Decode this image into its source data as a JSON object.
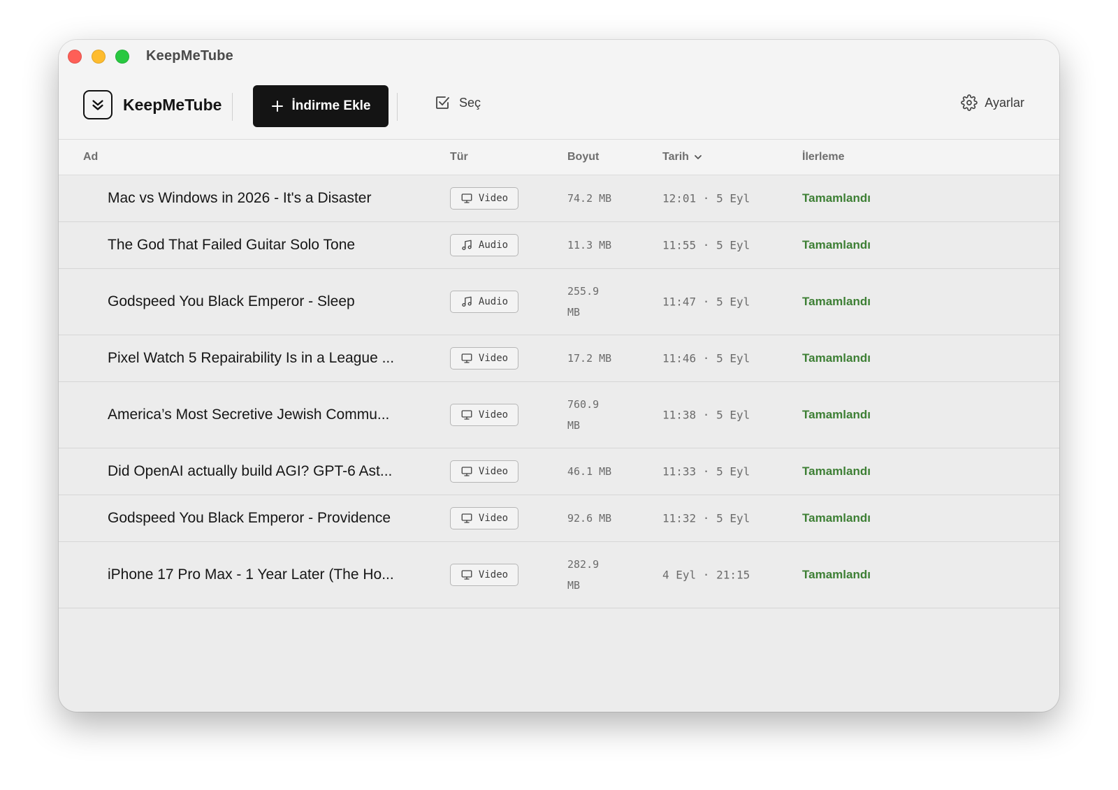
{
  "window": {
    "title": "KeepMeTube"
  },
  "toolbar": {
    "brand": "KeepMeTube",
    "add_label": "İndirme Ekle",
    "select_label": "Seç",
    "settings_label": "Ayarlar"
  },
  "columns": {
    "name": "Ad",
    "type": "Tür",
    "size": "Boyut",
    "date": "Tarih",
    "progress": "İlerleme"
  },
  "colors": {
    "accent": "#141414",
    "status_complete": "#3d7f34"
  },
  "rows": [
    {
      "name": "Mac vs Windows in 2026 - It's a Disaster",
      "type": "Video",
      "icon": "monitor-icon",
      "size": "74.2 MB",
      "date": "12:01 · 5 Eyl",
      "progress": "Tamamlandı"
    },
    {
      "name": "The God That Failed Guitar Solo Tone",
      "type": "Audio",
      "icon": "music-note-icon",
      "size": "11.3 MB",
      "date": "11:55 · 5 Eyl",
      "progress": "Tamamlandı"
    },
    {
      "name": "Godspeed You Black Emperor - Sleep",
      "type": "Audio",
      "icon": "music-note-icon",
      "size": "255.9 MB",
      "date": "11:47 · 5 Eyl",
      "progress": "Tamamlandı"
    },
    {
      "name": "Pixel Watch 5 Repairability Is in a League ...",
      "type": "Video",
      "icon": "monitor-icon",
      "size": "17.2 MB",
      "date": "11:46 · 5 Eyl",
      "progress": "Tamamlandı"
    },
    {
      "name": "America’s Most Secretive Jewish Commu...",
      "type": "Video",
      "icon": "monitor-icon",
      "size": "760.9 MB",
      "date": "11:38 · 5 Eyl",
      "progress": "Tamamlandı"
    },
    {
      "name": "Did OpenAI actually build AGI? GPT-6 Ast...",
      "type": "Video",
      "icon": "monitor-icon",
      "size": "46.1 MB",
      "date": "11:33 · 5 Eyl",
      "progress": "Tamamlandı"
    },
    {
      "name": "Godspeed You Black Emperor - Providence",
      "type": "Video",
      "icon": "monitor-icon",
      "size": "92.6 MB",
      "date": "11:32 · 5 Eyl",
      "progress": "Tamamlandı"
    },
    {
      "name": "iPhone 17 Pro Max - 1 Year Later (The Ho...",
      "type": "Video",
      "icon": "monitor-icon",
      "size": "282.9 MB",
      "date": "4 Eyl · 21:15",
      "progress": "Tamamlandı"
    }
  ]
}
